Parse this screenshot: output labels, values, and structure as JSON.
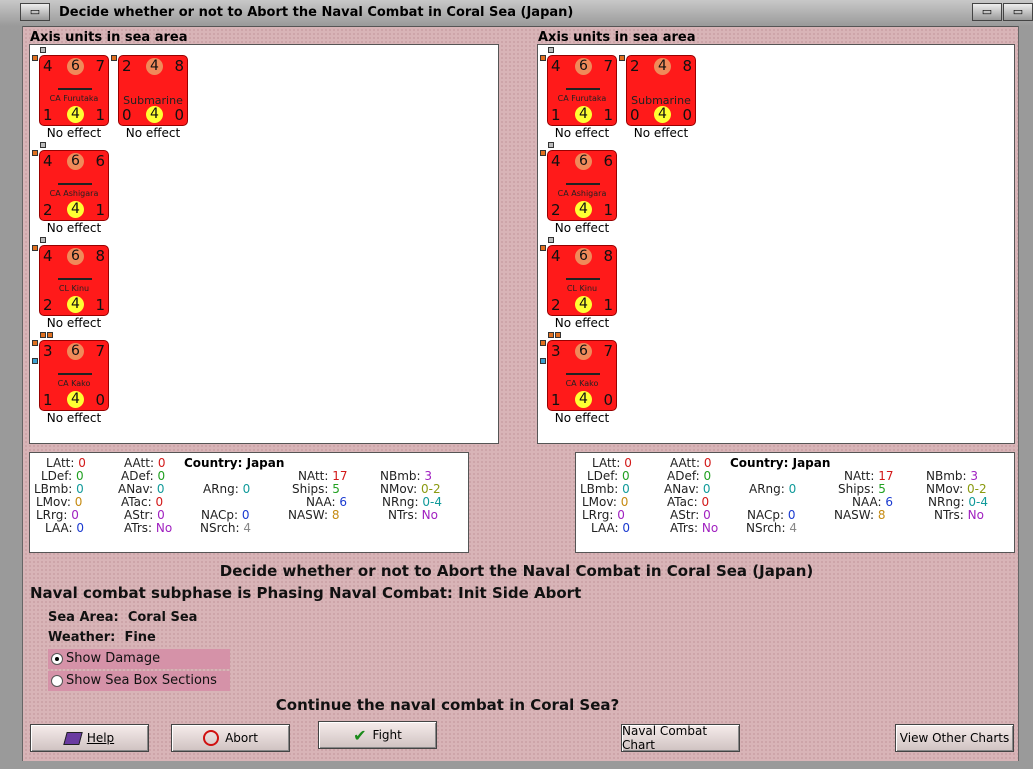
{
  "window": {
    "title": "Decide whether or not to Abort the Naval Combat in Coral Sea (Japan)"
  },
  "panels": {
    "left_heading": "Axis units in sea area",
    "right_heading": "Axis units in sea area"
  },
  "units": [
    {
      "name": "CA Furutaka",
      "tl": "4",
      "tc": "6",
      "tr": "7",
      "bl": "1",
      "bc": "4",
      "br": "1",
      "effect": "No effect"
    },
    {
      "name": "Submarine",
      "tl": "2",
      "tc": "4",
      "tr": "8",
      "bl": "0",
      "bc": "4",
      "br": "0",
      "effect": "No effect"
    },
    {
      "name": "CA Ashigara",
      "tl": "4",
      "tc": "6",
      "tr": "6",
      "bl": "2",
      "bc": "4",
      "br": "1",
      "effect": "No effect"
    },
    {
      "name": "CL Kinu",
      "tl": "4",
      "tc": "6",
      "tr": "8",
      "bl": "2",
      "bc": "4",
      "br": "1",
      "effect": "No effect"
    },
    {
      "name": "CA Kako",
      "tl": "3",
      "tc": "6",
      "tr": "7",
      "bl": "1",
      "bc": "4",
      "br": "0",
      "effect": "No effect"
    }
  ],
  "stats": {
    "country_label": "Country:",
    "country": "Japan",
    "latt": {
      "k": "LAtt:",
      "v": "0"
    },
    "ldef": {
      "k": "LDef:",
      "v": "0"
    },
    "lbmb": {
      "k": "LBmb:",
      "v": "0"
    },
    "lmov": {
      "k": "LMov:",
      "v": "0"
    },
    "lrrg": {
      "k": "LRrg:",
      "v": "0"
    },
    "laa": {
      "k": "LAA:",
      "v": "0"
    },
    "aatt": {
      "k": "AAtt:",
      "v": "0"
    },
    "adef": {
      "k": "ADef:",
      "v": "0"
    },
    "anav": {
      "k": "ANav:",
      "v": "0"
    },
    "atac": {
      "k": "ATac:",
      "v": "0"
    },
    "astr": {
      "k": "AStr:",
      "v": "0"
    },
    "atrs": {
      "k": "ATrs:",
      "v": "No"
    },
    "arng": {
      "k": "ARng:",
      "v": "0"
    },
    "nacp": {
      "k": "NACp:",
      "v": "0"
    },
    "nsrch": {
      "k": "NSrch:",
      "v": "4"
    },
    "natt": {
      "k": "NAtt:",
      "v": "17"
    },
    "ships": {
      "k": "Ships:",
      "v": "5"
    },
    "naa": {
      "k": "NAA:",
      "v": "6"
    },
    "nasw": {
      "k": "NASW:",
      "v": "8"
    },
    "nbmb": {
      "k": "NBmb:",
      "v": "3"
    },
    "nmov": {
      "k": "NMov:",
      "v": "0-2"
    },
    "nrng": {
      "k": "NRng:",
      "v": "0-4"
    },
    "ntrs": {
      "k": "NTrs:",
      "v": "No"
    }
  },
  "messages": {
    "main": "Decide whether or not to Abort the Naval Combat in Coral Sea (Japan)",
    "subphase": "Naval combat subphase is Phasing Naval Combat: Init Side Abort",
    "sea_area_label": "Sea Area:",
    "sea_area": "Coral Sea",
    "weather_label": "Weather:",
    "weather": "Fine",
    "question": "Continue the naval combat in Coral Sea?"
  },
  "options": {
    "show_damage": "Show Damage",
    "show_sea_box": "Show Sea Box Sections"
  },
  "buttons": {
    "help": "Help",
    "abort": "Abort",
    "fight": "Fight",
    "naval_chart": "Naval Combat Chart",
    "other_charts": "View Other Charts"
  }
}
